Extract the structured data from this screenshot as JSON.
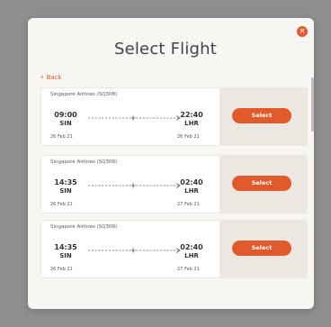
{
  "modal": {
    "title": "Select Flight",
    "back_label": "Back",
    "close_glyph": "×"
  },
  "flights": [
    {
      "airline": "Singapore Airlines (SQ308)",
      "depart_time": "09:00",
      "depart_code": "SIN",
      "depart_date": "26 Feb 21",
      "arrive_time": "22:40",
      "arrive_code": "LHR",
      "arrive_date": "26 Feb 21",
      "select_label": "Select"
    },
    {
      "airline": "Singapore Airlines (SQ308)",
      "depart_time": "14:35",
      "depart_code": "SIN",
      "depart_date": "26 Feb 21",
      "arrive_time": "02:40",
      "arrive_code": "LHR",
      "arrive_date": "27 Feb 21",
      "select_label": "Select"
    },
    {
      "airline": "Singapore Airlines (SQ308)",
      "depart_time": "14:35",
      "depart_code": "SIN",
      "depart_date": "26 Feb 21",
      "arrive_time": "02:40",
      "arrive_code": "LHR",
      "arrive_date": "27 Feb 21",
      "select_label": "Select"
    }
  ],
  "colors": {
    "accent": "#e15a2b",
    "card_side": "#ece8e1",
    "backdrop": "#8e8e8e"
  }
}
